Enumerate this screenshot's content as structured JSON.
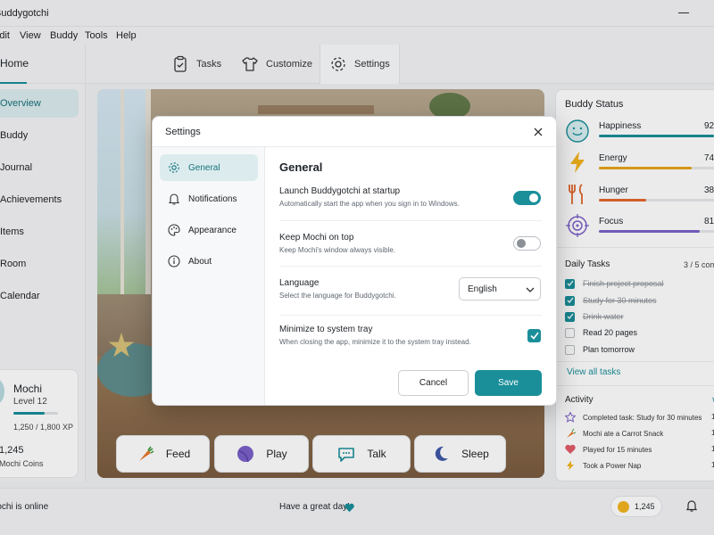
{
  "app": {
    "title": "Buddygotchi"
  },
  "menu": [
    "Edit",
    "View",
    "Buddy",
    "Tools",
    "Help"
  ],
  "nav": {
    "home": "Home",
    "tabs": [
      "Tasks",
      "Customize",
      "Settings"
    ]
  },
  "sidebar": {
    "items": [
      "Overview",
      "Buddy",
      "Journal",
      "Achievements",
      "Items",
      "Room",
      "Calendar"
    ]
  },
  "profile": {
    "name": "Mochi",
    "level": "Level 12",
    "xp": "1,250 / 1,800 XP",
    "xp_progress": 0.694,
    "coins": "1,245",
    "coins_label": "Mochi Coins"
  },
  "actions": [
    "Feed",
    "Play",
    "Talk",
    "Sleep"
  ],
  "status": {
    "title": "Buddy Status",
    "stats": [
      {
        "name": "Happiness",
        "value": "92",
        "level": 0.92,
        "color": "#1a8f9a",
        "icon": "smile-icon"
      },
      {
        "name": "Energy",
        "value": "74",
        "level": 0.74,
        "color": "#e8a317",
        "icon": "lightning-icon"
      },
      {
        "name": "Hunger",
        "value": "38",
        "level": 0.38,
        "color": "#e2672c",
        "icon": "fork-knife-icon"
      },
      {
        "name": "Focus",
        "value": "81",
        "level": 0.81,
        "color": "#7b61c9",
        "icon": "target-icon"
      }
    ]
  },
  "tasks": {
    "title": "Daily Tasks",
    "count": "3 / 5 com",
    "items": [
      {
        "label": "Finish project proposal",
        "done": true
      },
      {
        "label": "Study for 30 minutes",
        "done": true
      },
      {
        "label": "Drink water",
        "done": true
      },
      {
        "label": "Read 20 pages",
        "done": false
      },
      {
        "label": "Plan tomorrow",
        "done": false
      }
    ],
    "view_all": "View all tasks"
  },
  "activity": {
    "title": "Activity",
    "items": [
      {
        "text": "Completed task: Study for 30 minutes",
        "time": "1",
        "icon": "star-icon"
      },
      {
        "text": "Mochi ate a Carrot Snack",
        "time": "1",
        "icon": "carrot-icon"
      },
      {
        "text": "Played for 15 minutes",
        "time": "1",
        "icon": "heart-icon"
      },
      {
        "text": "Took a Power Nap",
        "time": "1",
        "icon": "lightning-icon"
      }
    ]
  },
  "statusbar": {
    "online": "Mochi is online",
    "message": "Have a great day!",
    "coins": "1,245"
  },
  "dialog": {
    "title": "Settings",
    "nav": [
      "General",
      "Notifications",
      "Appearance",
      "About"
    ],
    "section": "General",
    "settings": [
      {
        "label": "Launch Buddygotchi at startup",
        "desc": "Automatically start the app when you sign in to Windows.",
        "on": true
      },
      {
        "label": "Keep Mochi on top",
        "desc": "Keep Mochi's window always visible.",
        "on": false
      },
      {
        "label": "Language",
        "desc": "Select the language for Buddygotchi.",
        "value": "English"
      },
      {
        "label": "Minimize to system tray",
        "desc": "When closing the app, minimize it to the system tray instead.",
        "checked": true
      }
    ],
    "cancel": "Cancel",
    "save": "Save"
  }
}
